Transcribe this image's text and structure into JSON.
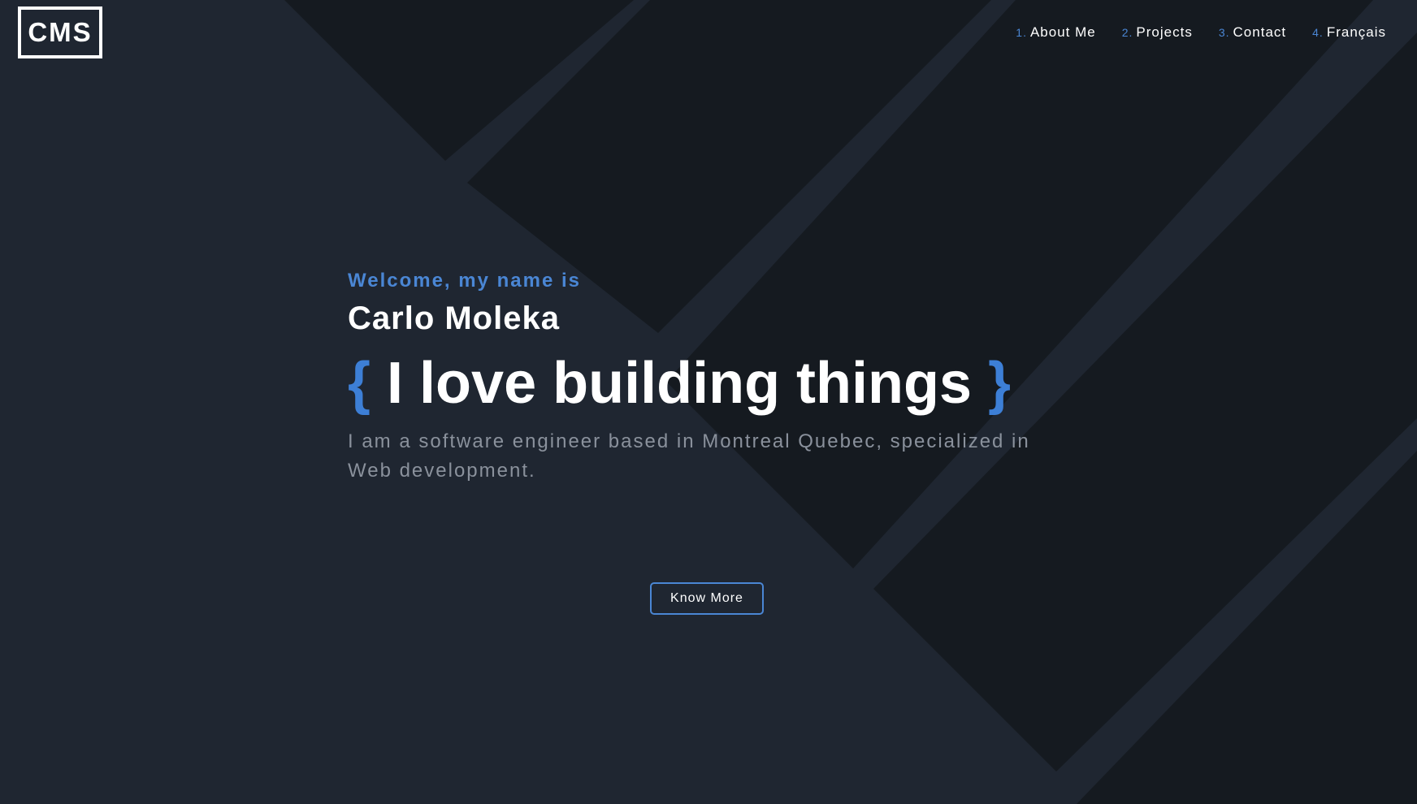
{
  "logo": {
    "text": "CMS"
  },
  "nav": {
    "items": [
      {
        "num": "1",
        "label": "About Me"
      },
      {
        "num": "2",
        "label": "Projects"
      },
      {
        "num": "3",
        "label": "Contact"
      },
      {
        "num": "4",
        "label": "Français"
      }
    ],
    "separator": "."
  },
  "hero": {
    "welcome": "Welcome, my name is",
    "name": "Carlo Moleka",
    "tagline": {
      "open_brace": "{",
      "text": "I love building things",
      "close_brace": "}"
    },
    "description": "I am a software engineer based in Montreal Quebec, specialized in Web development."
  },
  "cta": {
    "label": "Know More"
  },
  "colors": {
    "background": "#1f2631",
    "dark_panel": "#151a20",
    "accent": "#4a86d4",
    "text": "#ffffff",
    "muted_text": "#8a919c"
  }
}
